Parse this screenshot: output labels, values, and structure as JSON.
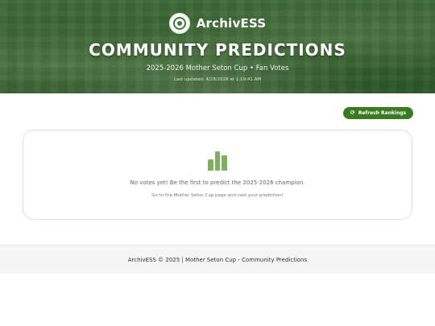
{
  "brand": {
    "name": "ArchivESS",
    "logo_icon": "seal-logo-icon"
  },
  "hero": {
    "title": "COMMUNITY PREDICTIONS",
    "subtitle": "2025-2026 Mother Seton Cup • Fan Votes",
    "last_updated": "Last updated: 4/28/2026 at 1:19:41 AM"
  },
  "toolbar": {
    "refresh_label": "Refresh Rankings",
    "refresh_icon": "refresh-icon"
  },
  "empty_state": {
    "icon": "bar-chart-icon",
    "title": "No votes yet! Be the first to predict the 2025-2026 champion.",
    "hint": "Go to the Mother Seton Cup page and cast your prediction!"
  },
  "footer": {
    "text": "ArchivESS © 2025 | Mother Seton Cup - Community Predictions"
  },
  "colors": {
    "accent": "#3a7a20",
    "bar": "#7fb062",
    "hero_green": "#3e6a37"
  }
}
